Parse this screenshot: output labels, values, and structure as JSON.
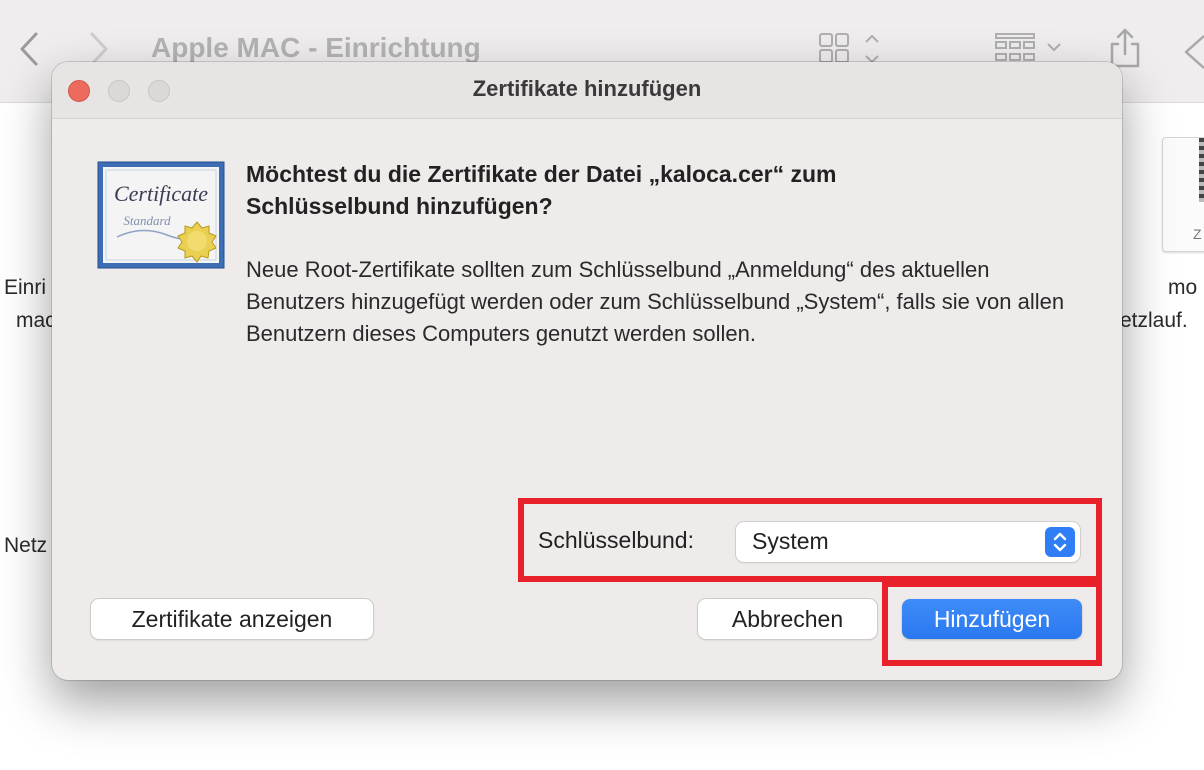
{
  "finder": {
    "window_title": "Apple MAC - Einrichtung",
    "labels": {
      "left_1": "Einri",
      "left_2": "mac",
      "left_3": "Netz",
      "right_1": "mo",
      "right_2": "etzlauf.",
      "thumb_label": "Z"
    }
  },
  "dialog": {
    "title": "Zertifikate hinzufügen",
    "icon_text": {
      "line1": "Certificate",
      "line2": "Standard"
    },
    "question": "Möchtest du die Zertifikate der Datei „kaloca.cer“ zum Schlüsselbund hinzufügen?",
    "info": "Neue Root-Zertifikate sollten zum Schlüsselbund „Anmeldung“ des aktuellen Benutzers hinzugefügt werden oder zum Schlüsselbund „System“, falls sie von allen Benutzern dieses Computers genutzt werden sollen.",
    "keychain_label": "Schlüsselbund:",
    "keychain_value": "System",
    "show_certs_label": "Zertifikate anzeigen",
    "cancel_label": "Abbrechen",
    "add_label": "Hinzufügen"
  },
  "colors": {
    "accent": "#2f7ef6",
    "annotation": "#e8202a",
    "close": "#ed6a5e"
  }
}
